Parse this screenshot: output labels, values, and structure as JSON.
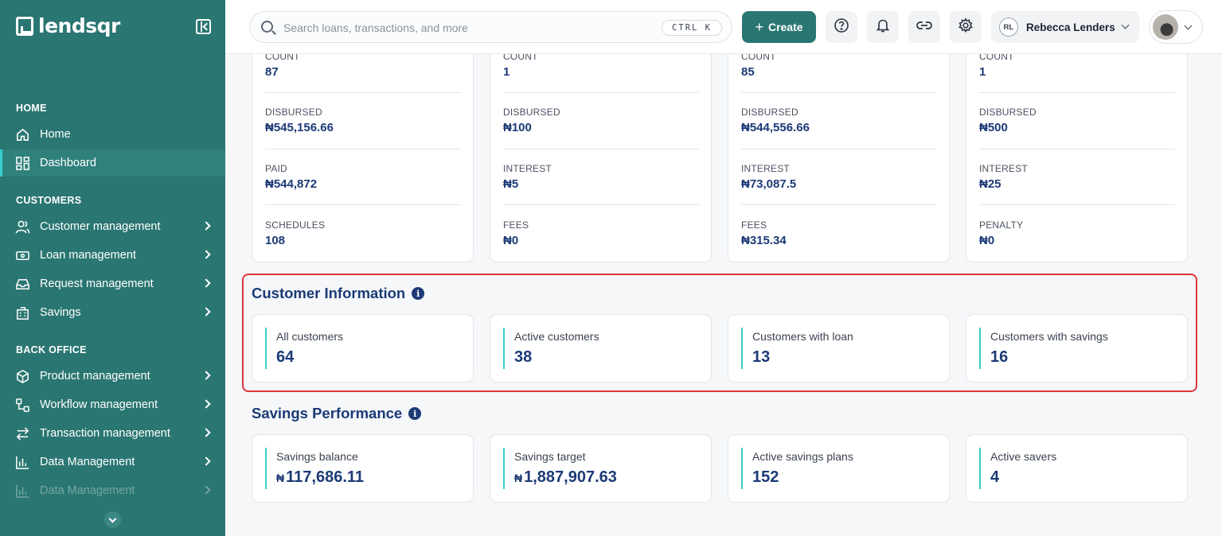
{
  "brand": {
    "name": "lendsqr"
  },
  "sidebar": {
    "sections": [
      {
        "label": "HOME"
      },
      {
        "label": "CUSTOMERS"
      },
      {
        "label": "BACK OFFICE"
      }
    ],
    "items": [
      {
        "label": "Home",
        "icon": "home-icon"
      },
      {
        "label": "Dashboard",
        "icon": "dashboard-icon",
        "active": true
      },
      {
        "label": "Customer management",
        "icon": "users-icon"
      },
      {
        "label": "Loan management",
        "icon": "loan-icon"
      },
      {
        "label": "Request management",
        "icon": "inbox-icon"
      },
      {
        "label": "Savings",
        "icon": "piggy-bank-icon"
      },
      {
        "label": "Product management",
        "icon": "box-icon"
      },
      {
        "label": "Workflow management",
        "icon": "workflow-icon"
      },
      {
        "label": "Transaction management",
        "icon": "transfer-icon"
      },
      {
        "label": "Data Management",
        "icon": "bar-chart-icon"
      },
      {
        "label": "Data Management",
        "icon": "bar-chart-icon"
      }
    ]
  },
  "header": {
    "search": {
      "placeholder": "Search loans, transactions, and more",
      "shortcut": "CTRL K"
    },
    "create_label": "Create",
    "user": {
      "initials": "RL",
      "name": "Rebecca Lenders"
    }
  },
  "loan_cards": [
    {
      "rows": [
        {
          "label": "COUNT",
          "value": "87"
        },
        {
          "label": "DISBURSED",
          "value": "₦545,156.66"
        },
        {
          "label": "PAID",
          "value": "₦544,872"
        },
        {
          "label": "SCHEDULES",
          "value": "108"
        }
      ]
    },
    {
      "rows": [
        {
          "label": "COUNT",
          "value": "1"
        },
        {
          "label": "DISBURSED",
          "value": "₦100"
        },
        {
          "label": "INTEREST",
          "value": "₦5"
        },
        {
          "label": "FEES",
          "value": "₦0"
        }
      ]
    },
    {
      "rows": [
        {
          "label": "COUNT",
          "value": "85"
        },
        {
          "label": "DISBURSED",
          "value": "₦544,556.66"
        },
        {
          "label": "INTEREST",
          "value": "₦73,087.5"
        },
        {
          "label": "FEES",
          "value": "₦315.34"
        }
      ]
    },
    {
      "rows": [
        {
          "label": "COUNT",
          "value": "1"
        },
        {
          "label": "DISBURSED",
          "value": "₦500"
        },
        {
          "label": "INTEREST",
          "value": "₦25"
        },
        {
          "label": "PENALTY",
          "value": "₦0"
        }
      ]
    }
  ],
  "customer_info": {
    "title": "Customer Information",
    "metrics": [
      {
        "label": "All customers",
        "value": "64"
      },
      {
        "label": "Active customers",
        "value": "38"
      },
      {
        "label": "Customers with loan",
        "value": "13"
      },
      {
        "label": "Customers with savings",
        "value": "16"
      }
    ]
  },
  "savings_performance": {
    "title": "Savings Performance",
    "metrics": [
      {
        "label": "Savings balance",
        "value": "117,686.11",
        "currency": "₦"
      },
      {
        "label": "Savings target",
        "value": "1,887,907.63",
        "currency": "₦"
      },
      {
        "label": "Active savings plans",
        "value": "152"
      },
      {
        "label": "Active savers",
        "value": "4"
      }
    ]
  },
  "colors": {
    "sidebar": "#2a7672",
    "accent": "#39cdcc",
    "navy": "#1c3a76",
    "highlight": "#e0353b"
  }
}
